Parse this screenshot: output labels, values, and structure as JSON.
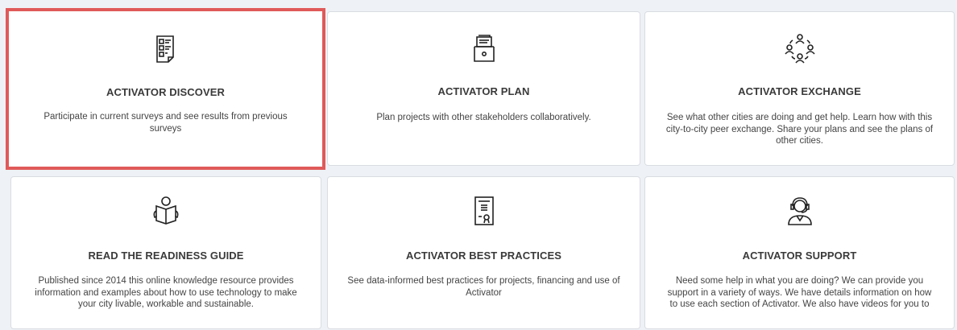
{
  "cards": [
    {
      "icon": "survey-document-icon",
      "title": "ACTIVATOR DISCOVER",
      "description": "Participate in current surveys and see results from previous surveys"
    },
    {
      "icon": "file-drawer-icon",
      "title": "ACTIVATOR PLAN",
      "description": "Plan projects with other stakeholders collaboratively."
    },
    {
      "icon": "people-exchange-icon",
      "title": "ACTIVATOR EXCHANGE",
      "description": "See what other cities are doing and get help. Learn how with this city-to-city peer exchange. Share your plans and see the plans of other cities."
    },
    {
      "icon": "reading-person-icon",
      "title": "READ THE READINESS GUIDE",
      "description": "Published since 2014 this online knowledge resource provides information and examples about how to use technology to make your city livable, workable and sustainable."
    },
    {
      "icon": "certificate-document-icon",
      "title": "ACTIVATOR BEST PRACTICES",
      "description": "See data-informed best practices for projects, financing and use of Activator"
    },
    {
      "icon": "support-headset-icon",
      "title": "ACTIVATOR SUPPORT",
      "description": "Need some help in what you are doing? We can provide you support in a variety of ways. We have details information on how to use each section of Activator. We also have videos for you to"
    }
  ],
  "colors": {
    "highlight": "#e05a5a",
    "icon_stroke": "#222222"
  }
}
